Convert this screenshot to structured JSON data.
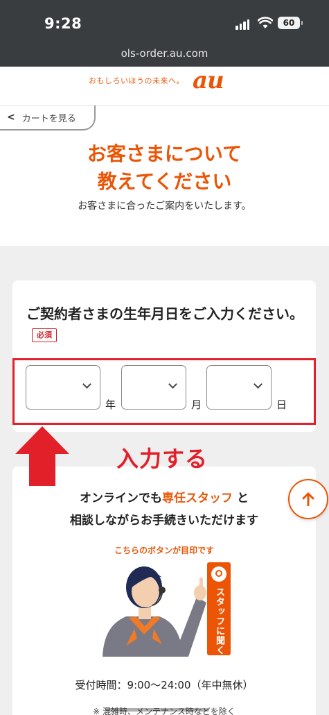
{
  "status_bar": {
    "time": "9:28",
    "battery": "60"
  },
  "browser": {
    "url": "ols-order.au.com"
  },
  "header": {
    "tagline": "おもしろいほうの未来へ。",
    "logo": "au"
  },
  "intro": {
    "back_button": "カートを見る",
    "title_line1": "お客さまについて",
    "title_line2": "教えてください",
    "subtitle": "お客さまに合ったご案内をいたします。"
  },
  "birthdate": {
    "question": "ご契約者さまの生年月日をご入力ください。",
    "required_badge": "必須",
    "year_unit": "年",
    "month_unit": "月",
    "day_unit": "日",
    "year_value": "",
    "month_value": "",
    "day_value": ""
  },
  "annotation": {
    "label": "入力する",
    "color": "#e1202a"
  },
  "staff": {
    "text_a": "オンラインでも",
    "text_highlight": "専任スタッフ",
    "text_b": "と",
    "text_line2": "相談しながらお手続きいただけます",
    "mark_note": "こちらのボタンが目印です",
    "button_label": "スタッフに聞く",
    "hours": "受付時間：9:00〜24:00（年中無休）",
    "note": "※ 混雑時、メンテナンス時などを除く"
  },
  "colors": {
    "brand_orange": "#eb5505",
    "alert_red": "#e1202a"
  },
  "icons": {
    "back": "chevron-left-icon",
    "scroll": "arrow-up-icon",
    "staff": "headset-icon"
  }
}
